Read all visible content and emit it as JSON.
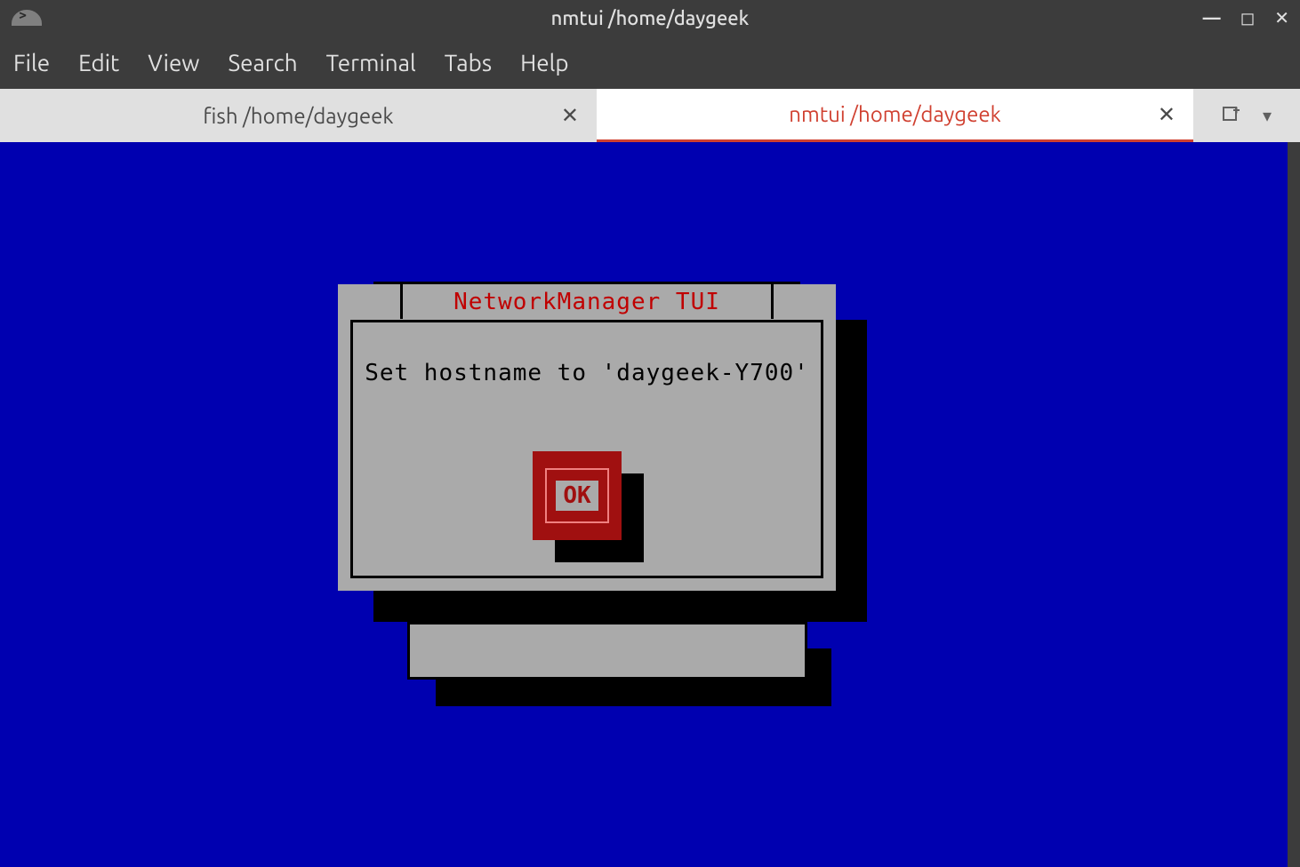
{
  "window": {
    "title": "nmtui  /home/daygeek"
  },
  "menu": {
    "file": "File",
    "edit": "Edit",
    "view": "View",
    "search": "Search",
    "terminal": "Terminal",
    "tabs": "Tabs",
    "help": "Help"
  },
  "tabs": [
    {
      "label": "fish  /home/daygeek",
      "active": false
    },
    {
      "label": "nmtui  /home/daygeek",
      "active": true
    }
  ],
  "dialog": {
    "title": "NetworkManager TUI",
    "message": "Set hostname to 'daygeek-Y700'",
    "ok_label": "OK"
  }
}
